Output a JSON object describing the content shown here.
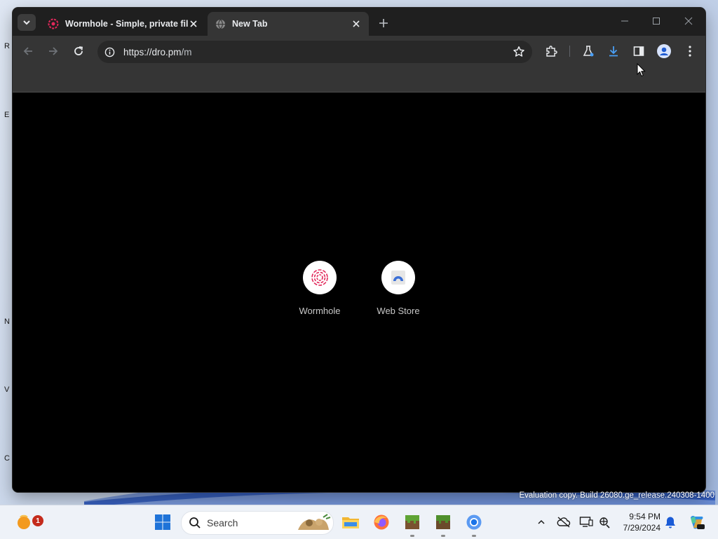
{
  "colors": {
    "accent_pink": "#e2285a",
    "chrome_bg": "#1f1f1f",
    "toolbar_bg": "#353535",
    "content_bg": "#000000",
    "download_blue": "#4a9ff5"
  },
  "browser": {
    "tabs": [
      {
        "label": "Wormhole - Simple, private fil",
        "icon": "wormhole-icon",
        "active": false
      },
      {
        "label": "New Tab",
        "icon": "globe-icon",
        "active": true
      }
    ],
    "omnibox": {
      "url_host": "https://dro.pm",
      "url_path": "/m"
    }
  },
  "new_tab": {
    "shortcuts": [
      {
        "title": "Wormhole",
        "icon": "wormhole-icon"
      },
      {
        "title": "Web Store",
        "icon": "web-store-icon"
      }
    ]
  },
  "desktop": {
    "watermark": "Evaluation copy. Build 26080.ge_release.240308-1400"
  },
  "taskbar": {
    "search_label": "Search",
    "notification_badge": "1",
    "clock_time": "9:54 PM",
    "clock_date": "7/29/2024"
  }
}
